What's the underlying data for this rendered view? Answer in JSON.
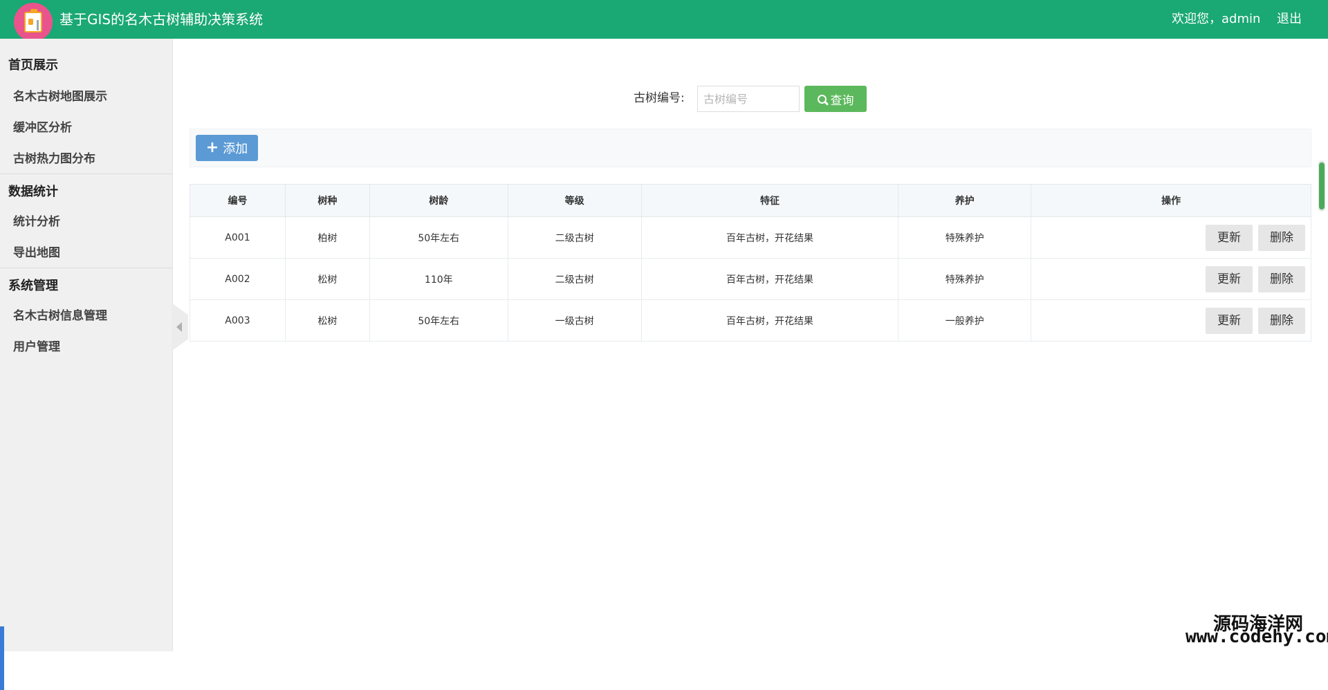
{
  "header": {
    "title": "基于GIS的名木古树辅助决策系统",
    "welcome": "欢迎您，admin",
    "logout": "退出"
  },
  "sidebar": {
    "groups": [
      {
        "title": "首页展示",
        "items": [
          "名木古树地图展示",
          "缓冲区分析",
          "古树热力图分布"
        ]
      },
      {
        "title": "数据统计",
        "items": [
          "统计分析",
          "导出地图"
        ]
      },
      {
        "title": "系统管理",
        "items": [
          "名木古树信息管理",
          "用户管理"
        ]
      }
    ]
  },
  "search": {
    "label": "古树编号:",
    "placeholder": "古树编号",
    "button": "查询"
  },
  "toolbar": {
    "add_label": "添加"
  },
  "table": {
    "headers": [
      "编号",
      "树种",
      "树龄",
      "等级",
      "特征",
      "养护",
      "操作"
    ],
    "rows": [
      {
        "id": "A001",
        "species": "柏树",
        "age": "50年左右",
        "level": "二级古树",
        "feature": "百年古树，开花结果",
        "care": "特殊养护"
      },
      {
        "id": "A002",
        "species": "松树",
        "age": "110年",
        "level": "二级古树",
        "feature": "百年古树，开花结果",
        "care": "特殊养护"
      },
      {
        "id": "A003",
        "species": "松树",
        "age": "50年左右",
        "level": "一级古树",
        "feature": "百年古树，开花结果",
        "care": "一般养护"
      }
    ],
    "update_label": "更新",
    "delete_label": "删除"
  },
  "watermark": {
    "line1": "源码海洋网",
    "line2": "www.codehy.com"
  },
  "colors": {
    "header_bg": "#1aa874",
    "search_button": "#5cb85c",
    "add_button": "#5b9ad5"
  },
  "icons": {
    "logo": "clipboard-id-icon",
    "search": "search-icon",
    "add": "plus-icon",
    "collapse": "chevron-left-icon"
  }
}
